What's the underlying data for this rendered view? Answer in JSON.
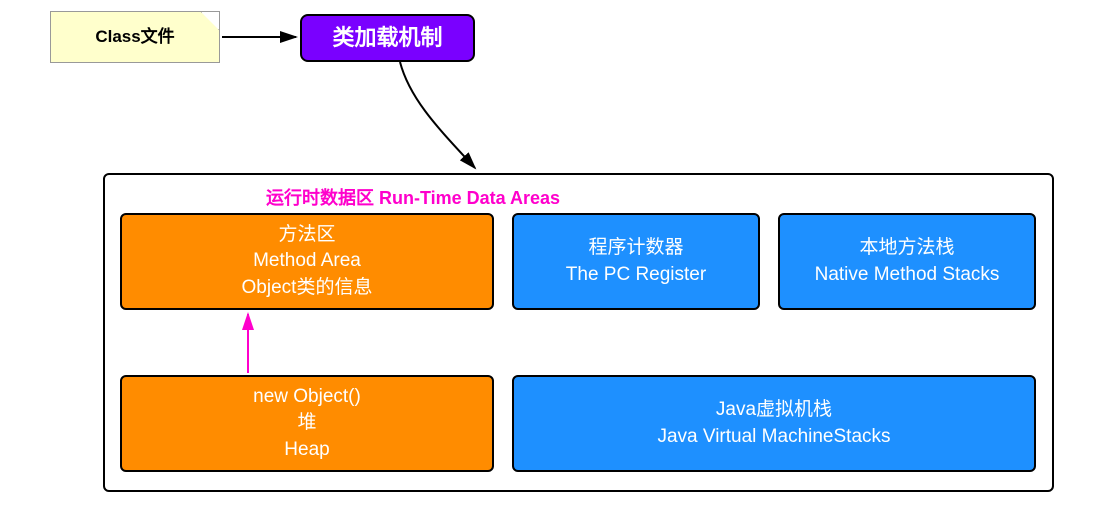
{
  "note": {
    "label": "Class文件"
  },
  "purple": {
    "label": "类加载机制"
  },
  "container": {
    "title": "运行时数据区 Run-Time Data Areas"
  },
  "method_area": {
    "line1": "方法区",
    "line2": "Method Area",
    "line3": "Object类的信息"
  },
  "pc_register": {
    "line1": "程序计数器",
    "line2": "The PC Register"
  },
  "native_stacks": {
    "line1": "本地方法栈",
    "line2": "Native Method Stacks"
  },
  "heap": {
    "line1": "new Object()",
    "line2": "堆",
    "line3": "Heap"
  },
  "jvm_stacks": {
    "line1": "Java虚拟机栈",
    "line2": "Java Virtual MachineStacks"
  },
  "colors": {
    "note_bg": "#ffffcc",
    "purple": "#7a00ff",
    "orange": "#ff8c00",
    "blue": "#1e90ff",
    "title": "#ff00cc",
    "pink_arrow": "#ff00cc"
  }
}
